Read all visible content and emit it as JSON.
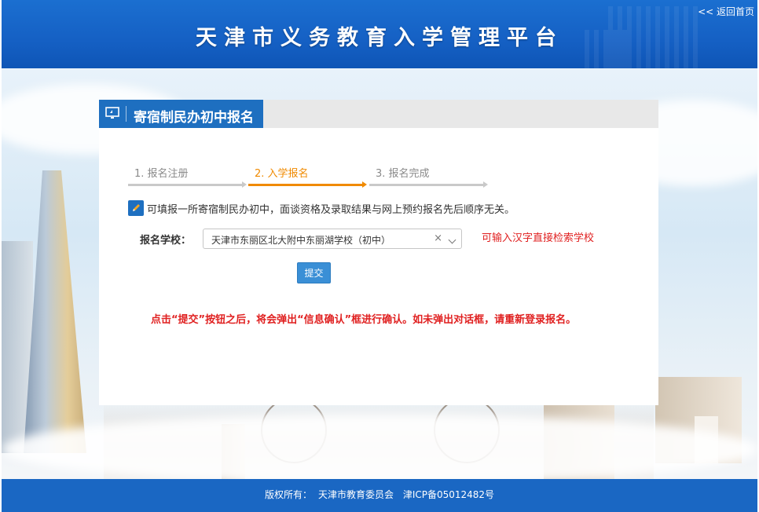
{
  "header": {
    "title": "天津市义务教育入学管理平台",
    "back_link": "<< 返回首页"
  },
  "panel": {
    "tab_title": "寄宿制民办初中报名",
    "tab_icon": "monitor-icon",
    "steps": [
      {
        "label": "1. 报名注册",
        "state": "done"
      },
      {
        "label": "2. 入学报名",
        "state": "active"
      },
      {
        "label": "3. 报名完成",
        "state": "pending"
      }
    ],
    "notice_icon": "pencil-icon",
    "notice": "可填报一所寄宿制民办初中，面谈资格及录取结果与网上预约报名先后顺序无关。",
    "form": {
      "school_label": "报名学校：",
      "school_value": "天津市东丽区北大附中东丽湖学校（初中）",
      "clear_symbol": "×",
      "hint": "可输入汉字直接检索学校",
      "submit_label": "提交"
    },
    "warning": "点击“提交”按钮之后，将会弹出“信息确认”框进行确认。如未弹出对话框，请重新登录报名。"
  },
  "footer": {
    "copyright": "版权所有：",
    "owner": "天津市教育委员会",
    "icp": "津ICP备05012482号"
  },
  "colors": {
    "header_blue": "#1560c4",
    "accent_orange": "#f08a00",
    "warning_red": "#e02020",
    "button_blue": "#3a8fd6"
  }
}
